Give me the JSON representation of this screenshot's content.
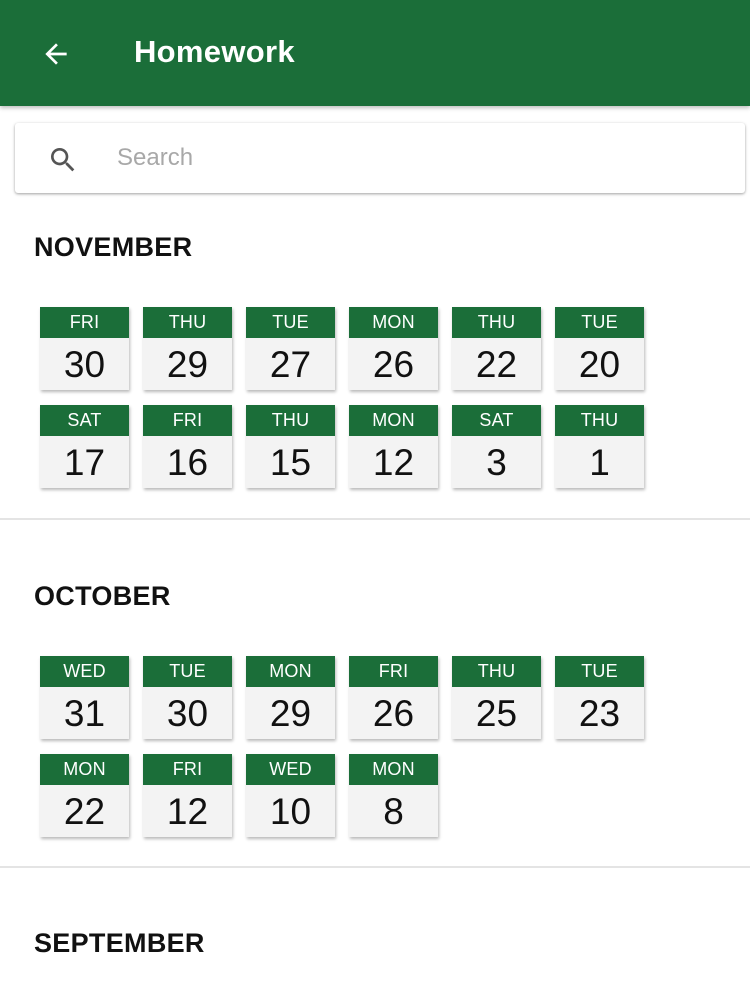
{
  "appbar": {
    "title": "Homework",
    "back_icon": "arrow-back-icon",
    "background": "#1b6e39"
  },
  "search": {
    "placeholder": "Search",
    "value": "",
    "icon": "search-icon"
  },
  "months": [
    {
      "name": "NOVEMBER",
      "dates": [
        {
          "day": "FRI",
          "date": "30"
        },
        {
          "day": "THU",
          "date": "29"
        },
        {
          "day": "TUE",
          "date": "27"
        },
        {
          "day": "MON",
          "date": "26"
        },
        {
          "day": "THU",
          "date": "22"
        },
        {
          "day": "TUE",
          "date": "20"
        },
        {
          "day": "SAT",
          "date": "17"
        },
        {
          "day": "FRI",
          "date": "16"
        },
        {
          "day": "THU",
          "date": "15"
        },
        {
          "day": "MON",
          "date": "12"
        },
        {
          "day": "SAT",
          "date": "3"
        },
        {
          "day": "THU",
          "date": "1"
        }
      ]
    },
    {
      "name": "OCTOBER",
      "dates": [
        {
          "day": "WED",
          "date": "31"
        },
        {
          "day": "TUE",
          "date": "30"
        },
        {
          "day": "MON",
          "date": "29"
        },
        {
          "day": "FRI",
          "date": "26"
        },
        {
          "day": "THU",
          "date": "25"
        },
        {
          "day": "TUE",
          "date": "23"
        },
        {
          "day": "MON",
          "date": "22"
        },
        {
          "day": "FRI",
          "date": "12"
        },
        {
          "day": "WED",
          "date": "10"
        },
        {
          "day": "MON",
          "date": "8"
        }
      ]
    },
    {
      "name": "SEPTEMBER",
      "dates": []
    }
  ]
}
